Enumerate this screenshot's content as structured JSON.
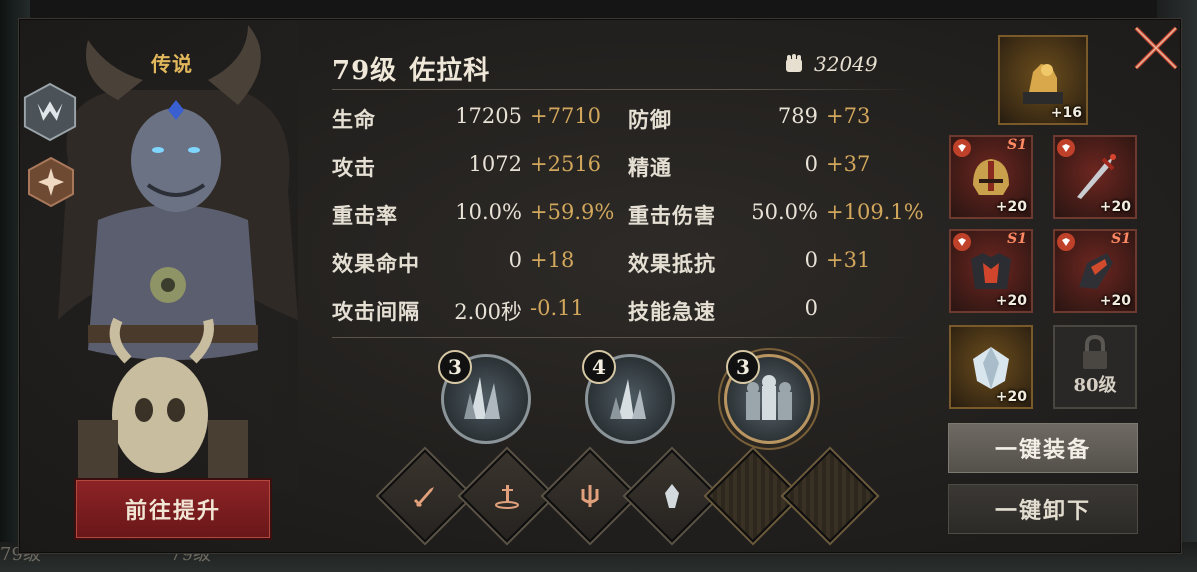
{
  "background": {
    "level_text_left": "79级",
    "level_text_mid": "79级"
  },
  "hero": {
    "rarity": "传说",
    "level_label": "79级",
    "name": "佐拉科",
    "power": "32049",
    "class_icon": "claw-crest-icon",
    "element_icon": "star-burst-icon"
  },
  "stats": [
    {
      "label": "生命",
      "base": "17205",
      "bonus": "+7710"
    },
    {
      "label": "防御",
      "base": "789",
      "bonus": "+73"
    },
    {
      "label": "攻击",
      "base": "1072",
      "bonus": "+2516"
    },
    {
      "label": "精通",
      "base": "0",
      "bonus": "+37"
    },
    {
      "label": "重击率",
      "base": "10.0%",
      "bonus": "+59.9%"
    },
    {
      "label": "重击伤害",
      "base": "50.0%",
      "bonus": "+109.1%"
    },
    {
      "label": "效果命中",
      "base": "0",
      "bonus": "+18"
    },
    {
      "label": "效果抵抗",
      "base": "0",
      "bonus": "+31"
    },
    {
      "label": "攻击间隔",
      "base": "2.00秒",
      "bonus": "-0.11"
    },
    {
      "label": "技能急速",
      "base": "0",
      "bonus": ""
    }
  ],
  "skills": [
    {
      "level": "3",
      "icon": "crystal-shards-icon"
    },
    {
      "level": "4",
      "icon": "crystal-shards-icon"
    },
    {
      "level": "3",
      "icon": "armored-soldiers-icon"
    }
  ],
  "runes": [
    {
      "icon": "sword-icon",
      "state": "active"
    },
    {
      "icon": "ground-dagger-icon",
      "state": "active"
    },
    {
      "icon": "trident-icon",
      "state": "active"
    },
    {
      "icon": "crystal-icon",
      "state": "active"
    },
    {
      "icon": "empty-slot",
      "state": "empty"
    },
    {
      "icon": "empty-slot",
      "state": "empty"
    }
  ],
  "equipment": {
    "artifact": {
      "icon": "golden-beast-statue-icon",
      "level": "+16"
    },
    "helmet": {
      "icon": "helmet-icon",
      "tier": "S1",
      "level": "+20"
    },
    "weapon": {
      "icon": "dagger-icon",
      "tier": "",
      "level": "+20"
    },
    "armor": {
      "icon": "armor-icon",
      "tier": "S1",
      "level": "+20"
    },
    "gauntlet": {
      "icon": "gauntlet-icon",
      "tier": "S1",
      "level": "+20"
    },
    "gem": {
      "icon": "gem-icon",
      "level": "+20"
    },
    "locked": {
      "icon": "lock-icon",
      "label": "80级"
    }
  },
  "buttons": {
    "upgrade": "前往提升",
    "equip_all": "一键装备",
    "unequip_all": "一键卸下"
  },
  "colors": {
    "bonus": "#d2a75c",
    "rarity": "#e2b85d",
    "upgrade_button": "#8c2326",
    "close": "#c4452e"
  }
}
